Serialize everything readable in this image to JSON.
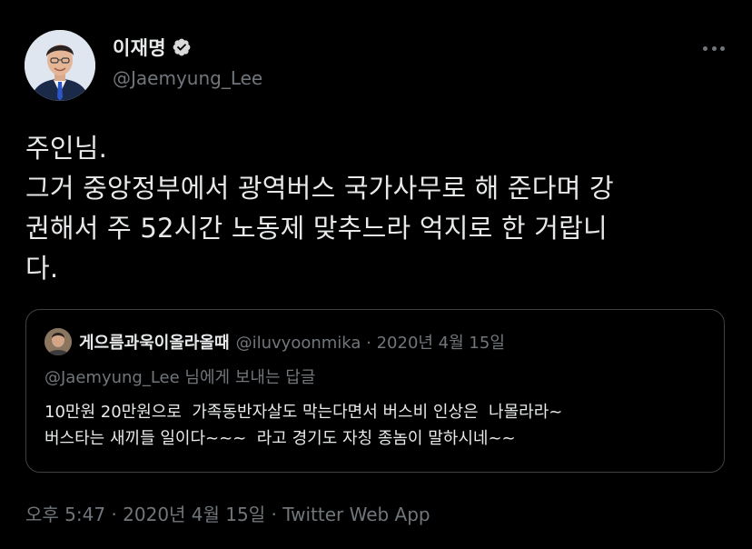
{
  "author": {
    "display_name": "이재명",
    "handle": "@Jaemyung_Lee",
    "verified_icon": "verified-badge-icon"
  },
  "menu": {
    "more_icon": "more-horizontal-icon"
  },
  "tweet": {
    "text": "주인님.\n그거 중앙정부에서 광역버스 국가사무로 해 준다며 강\n권해서 주 52시간 노동제 맞추느라 억지로 한 거랍니\n다."
  },
  "quote": {
    "display_name": "게으름과욱이올라올때",
    "meta": "@iluvyoonmika · 2020년 4월 15일",
    "reply_context": "@Jaemyung_Lee 님에게 보내는 답글",
    "text": "10만원 20만원으로  가족동반자살도 막는다면서 버스비 인상은  나몰라라~\n버스타는 새끼들 일이다~~~  라고 경기도 자칭 종놈이 말하시네~~"
  },
  "footer": {
    "timestamp": "오후 5:47 · 2020년 4월 15일 · Twitter Web App"
  },
  "colors": {
    "background": "#000000",
    "primary_text": "#e7e9ea",
    "secondary_text": "#71767b",
    "border": "#3e4144",
    "verified_badge": "#d9d9d9"
  }
}
